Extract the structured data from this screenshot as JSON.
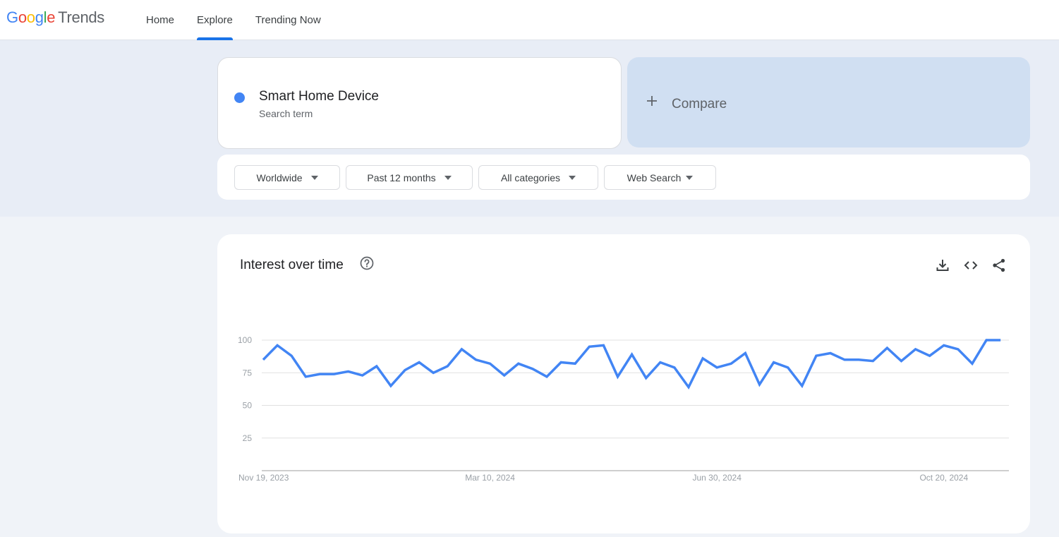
{
  "header": {
    "logo": {
      "google": [
        "G",
        "o",
        "o",
        "g",
        "l",
        "e"
      ],
      "product": "Trends"
    },
    "nav": [
      {
        "label": "Home",
        "active": false
      },
      {
        "label": "Explore",
        "active": true
      },
      {
        "label": "Trending Now",
        "active": false
      }
    ]
  },
  "search_term": {
    "name": "Smart Home Device",
    "type": "Search term",
    "color": "#4285f4"
  },
  "compare": {
    "icon": "plus-icon",
    "label": "Compare"
  },
  "filters": [
    {
      "label": "Worldwide"
    },
    {
      "label": "Past 12 months"
    },
    {
      "label": "All categories"
    },
    {
      "label": "Web Search"
    }
  ],
  "interest_card": {
    "title": "Interest over time",
    "icons": [
      "help-icon",
      "download-icon",
      "embed-code-icon",
      "share-icon"
    ]
  },
  "colors": {
    "accent": "#1a73e8",
    "series": "#4285f4",
    "compare_bg": "#d0dff2",
    "band_bg": "#e8edf6",
    "page_bg": "#f0f3f8"
  },
  "chart_data": {
    "type": "line",
    "title": "Interest over time",
    "xlabel": "",
    "ylabel": "",
    "ylim": [
      0,
      100
    ],
    "yticks": [
      25,
      50,
      75,
      100
    ],
    "grid": true,
    "x_tick_labels": [
      {
        "label": "Nov 19, 2023",
        "index": 0
      },
      {
        "label": "Mar 10, 2024",
        "index": 16
      },
      {
        "label": "Jun 30, 2024",
        "index": 32
      },
      {
        "label": "Oct 20, 2024",
        "index": 48
      }
    ],
    "x_start": "Nov 19, 2023",
    "x_interval": "weekly",
    "series": [
      {
        "name": "Smart Home Device",
        "color": "#4285f4",
        "values": [
          85,
          96,
          88,
          72,
          74,
          74,
          76,
          73,
          80,
          65,
          77,
          83,
          75,
          80,
          93,
          85,
          82,
          73,
          82,
          78,
          72,
          83,
          82,
          95,
          96,
          72,
          89,
          71,
          83,
          79,
          64,
          86,
          79,
          82,
          90,
          66,
          83,
          79,
          65,
          88,
          90,
          85,
          85,
          84,
          94,
          84,
          93,
          88,
          96,
          93,
          82,
          100,
          100
        ]
      }
    ]
  }
}
